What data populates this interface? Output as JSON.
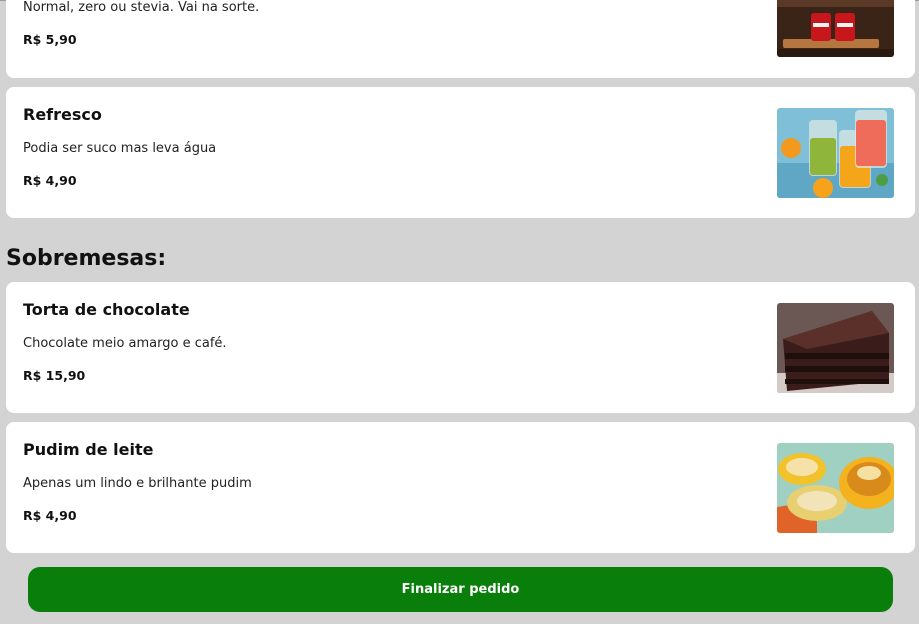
{
  "drinks": {
    "items": [
      {
        "title": "",
        "desc": "Normal, zero ou stevia. Vai na sorte.",
        "price": "R$ 5,90",
        "image": "soda-cans-image"
      },
      {
        "title": "Refresco",
        "desc": "Podia ser suco mas leva água",
        "price": "R$ 4,90",
        "image": "juice-glasses-image"
      }
    ]
  },
  "desserts": {
    "heading": "Sobremesas:",
    "items": [
      {
        "title": "Torta de chocolate",
        "desc": "Chocolate meio amargo e café.",
        "price": "R$ 15,90",
        "image": "chocolate-cake-image"
      },
      {
        "title": "Pudim de leite",
        "desc": "Apenas um lindo e brilhante pudim",
        "price": "R$ 4,90",
        "image": "pudding-image"
      }
    ]
  },
  "footer": {
    "checkout_label": "Finalizar pedido"
  },
  "colors": {
    "background": "#d3d3d3",
    "card": "#ffffff",
    "accent": "#0a7e0a"
  }
}
